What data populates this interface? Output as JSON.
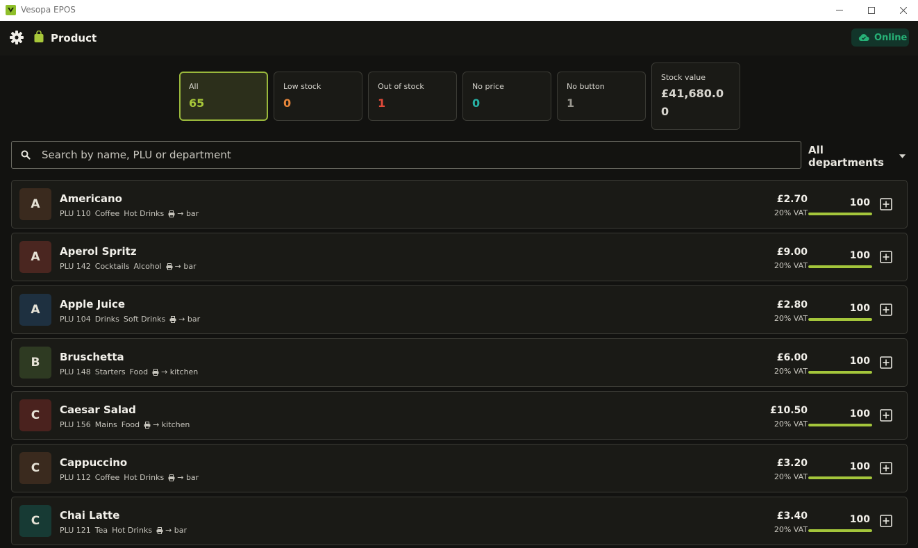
{
  "window": {
    "title": "Vesopa EPOS"
  },
  "header": {
    "title": "Product",
    "status": "Online"
  },
  "stats": [
    {
      "label": "All",
      "value": "65",
      "color": "#a8c83a",
      "active": true
    },
    {
      "label": "Low stock",
      "value": "0",
      "color": "#e8863a"
    },
    {
      "label": "Out of stock",
      "value": "1",
      "color": "#e34b3a"
    },
    {
      "label": "No price",
      "value": "0",
      "color": "#27b2a6"
    },
    {
      "label": "No button",
      "value": "1",
      "color": "#9a9890"
    },
    {
      "label": "Stock value",
      "value": "£41,680.00",
      "color": "#d8d6cf"
    }
  ],
  "search": {
    "placeholder": "Search by name, PLU or department",
    "value": ""
  },
  "department_filter": {
    "selected": "All departments"
  },
  "products": [
    {
      "initial": "A",
      "avatar_color": "#3a2a1e",
      "name": "Americano",
      "plu": "PLU 110",
      "category": "Coffee",
      "department": "Hot Drinks",
      "route": "→ bar",
      "price": "£2.70",
      "vat": "20% VAT",
      "stock": "100",
      "stock_level": 1.0
    },
    {
      "initial": "A",
      "avatar_color": "#4a2620",
      "name": "Aperol Spritz",
      "plu": "PLU 142",
      "category": "Cocktails",
      "department": "Alcohol",
      "route": "→ bar",
      "price": "£9.00",
      "vat": "20% VAT",
      "stock": "100",
      "stock_level": 1.0
    },
    {
      "initial": "A",
      "avatar_color": "#1e3040",
      "name": "Apple Juice",
      "plu": "PLU 104",
      "category": "Drinks",
      "department": "Soft Drinks",
      "route": "→ bar",
      "price": "£2.80",
      "vat": "20% VAT",
      "stock": "100",
      "stock_level": 1.0
    },
    {
      "initial": "B",
      "avatar_color": "#2e3a22",
      "name": "Bruschetta",
      "plu": "PLU 148",
      "category": "Starters",
      "department": "Food",
      "route": "→ kitchen",
      "price": "£6.00",
      "vat": "20% VAT",
      "stock": "100",
      "stock_level": 1.0
    },
    {
      "initial": "C",
      "avatar_color": "#4a221e",
      "name": "Caesar Salad",
      "plu": "PLU 156",
      "category": "Mains",
      "department": "Food",
      "route": "→ kitchen",
      "price": "£10.50",
      "vat": "20% VAT",
      "stock": "100",
      "stock_level": 1.0
    },
    {
      "initial": "C",
      "avatar_color": "#3a2a1e",
      "name": "Cappuccino",
      "plu": "PLU 112",
      "category": "Coffee",
      "department": "Hot Drinks",
      "route": "→ bar",
      "price": "£3.20",
      "vat": "20% VAT",
      "stock": "100",
      "stock_level": 1.0
    },
    {
      "initial": "C",
      "avatar_color": "#173a34",
      "name": "Chai Latte",
      "plu": "PLU 121",
      "category": "Tea",
      "department": "Hot Drinks",
      "route": "→ bar",
      "price": "£3.40",
      "vat": "20% VAT",
      "stock": "100",
      "stock_level": 1.0
    }
  ]
}
